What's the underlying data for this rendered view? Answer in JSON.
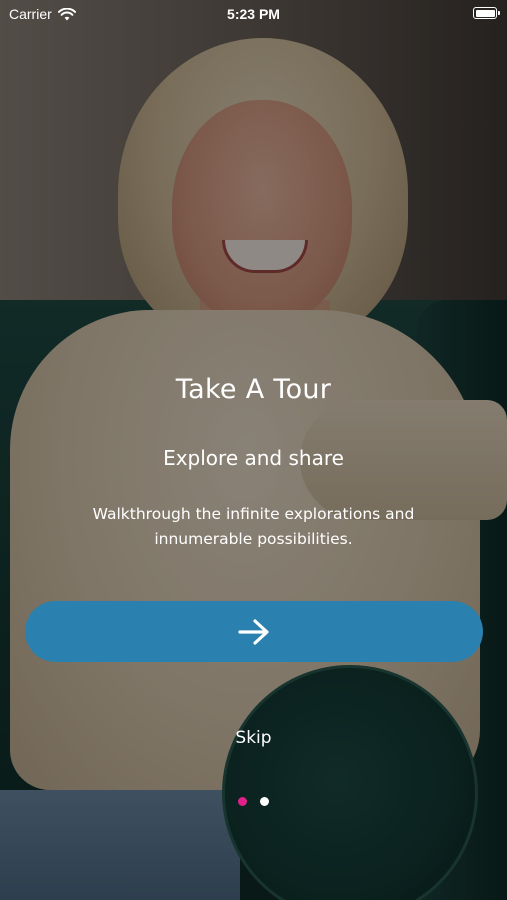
{
  "status_bar": {
    "carrier": "Carrier",
    "time": "5:23 PM"
  },
  "onboarding": {
    "title": "Take A Tour",
    "subtitle": "Explore and share",
    "description": "Walkthrough the infinite explorations and innumerable possibilities.",
    "next_icon": "arrow-right-icon",
    "skip_label": "Skip",
    "page_count": 2,
    "current_page": 1
  },
  "colors": {
    "button": "#2a80ae",
    "active_dot": "#e0218a",
    "inactive_dot": "#ffffff"
  }
}
